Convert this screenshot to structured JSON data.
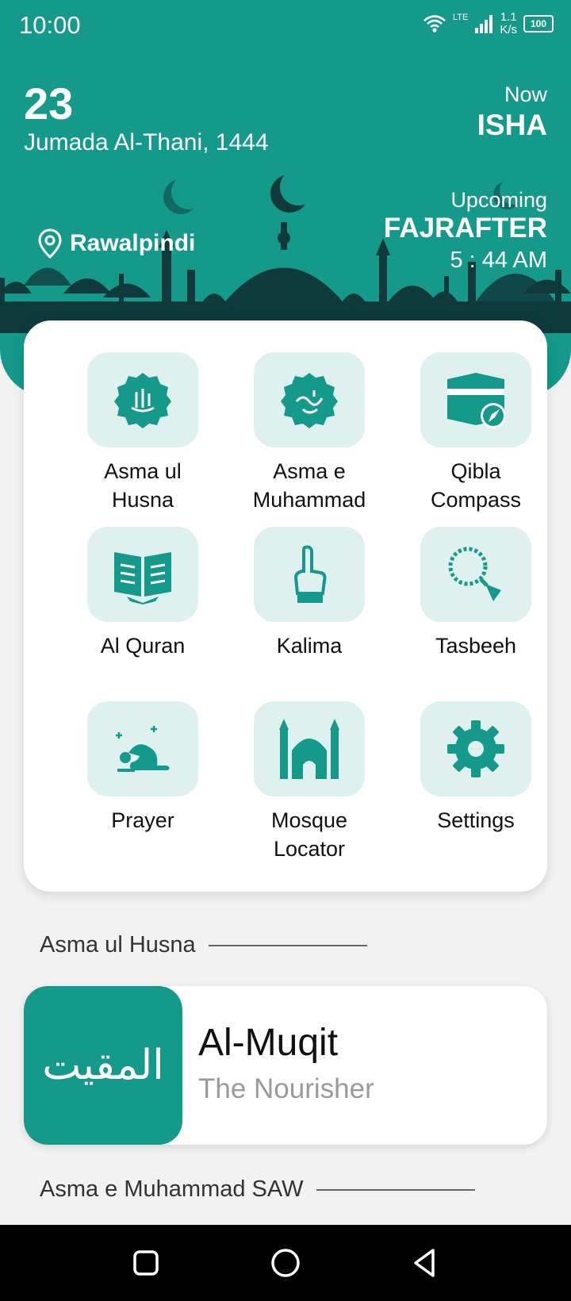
{
  "status": {
    "time": "10:00",
    "lte": "LTE",
    "speed_value": "1.1",
    "speed_unit": "K/s",
    "battery": "100"
  },
  "header": {
    "day": "23",
    "month_year": "Jumada Al-Thani, 1444",
    "now_label": "Now",
    "now_prayer": "ISHA",
    "upcoming_label": "Upcoming",
    "upcoming_prayer": "FAJRAFTER",
    "upcoming_time": "5 : 44 AM",
    "location": "Rawalpindi"
  },
  "menu": {
    "items": [
      {
        "label_line1": "Asma ul",
        "label_line2": "Husna",
        "icon": "allah-calligraphy-icon"
      },
      {
        "label_line1": "Asma e",
        "label_line2": "Muhammad",
        "icon": "muhammad-calligraphy-icon"
      },
      {
        "label_line1": "Qibla",
        "label_line2": "Compass",
        "icon": "kaaba-compass-icon"
      },
      {
        "label_line1": "Al Quran",
        "label_line2": "",
        "icon": "quran-icon"
      },
      {
        "label_line1": "Kalima",
        "label_line2": "",
        "icon": "raised-finger-icon"
      },
      {
        "label_line1": "Tasbeeh",
        "label_line2": "",
        "icon": "prayer-beads-icon"
      },
      {
        "label_line1": "Prayer",
        "label_line2": "",
        "icon": "prostration-icon"
      },
      {
        "label_line1": "Mosque",
        "label_line2": "Locator",
        "icon": "mosque-icon"
      },
      {
        "label_line1": "Settings",
        "label_line2": "",
        "icon": "gear-icon"
      }
    ]
  },
  "sections": {
    "asma_ul_husna": "Asma ul Husna",
    "asma_e_muhammad": "Asma e Muhammad SAW"
  },
  "name_card": {
    "arabic": "المقيت",
    "title": "Al-Muqit",
    "meaning": "The Nourisher"
  },
  "colors": {
    "primary": "#15998a",
    "tile_bg": "#dff1ef",
    "skyline": "#0f3a3c"
  }
}
